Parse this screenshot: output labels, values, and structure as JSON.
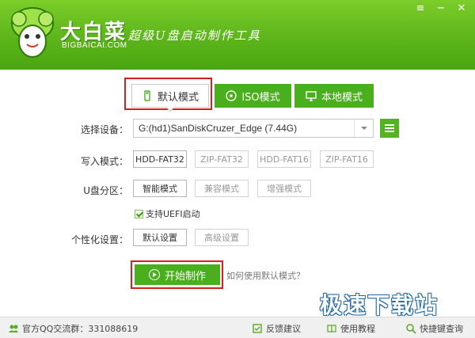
{
  "header": {
    "brand": "大白菜",
    "brand_sub": "BIGBAICAI.COM",
    "slogan": "超级U盘启动制作工具",
    "window_buttons": [
      "menu",
      "minimize",
      "close"
    ]
  },
  "tabs": [
    {
      "label": "默认模式",
      "icon": "usb-icon",
      "active": true
    },
    {
      "label": "ISO模式",
      "icon": "disc-icon",
      "active": false
    },
    {
      "label": "本地模式",
      "icon": "monitor-icon",
      "active": false
    }
  ],
  "form": {
    "device_label": "选择设备：",
    "device_value": "G:(hd1)SanDiskCruzer_Edge (7.44G)",
    "write_mode_label": "写入模式：",
    "write_modes": [
      "HDD-FAT32",
      "ZIP-FAT32",
      "HDD-FAT16",
      "ZIP-FAT16"
    ],
    "write_mode_selected": "HDD-FAT32",
    "partition_label": "U盘分区：",
    "partition_modes": [
      "智能模式",
      "兼容模式",
      "增强模式"
    ],
    "partition_selected": "智能模式",
    "uefi_label": "支持UEFI启动",
    "uefi_checked": true,
    "personal_label": "个性化设置：",
    "personal_modes": [
      "默认设置",
      "高级设置"
    ],
    "personal_selected": "默认设置"
  },
  "actions": {
    "start_label": "开始制作",
    "help_link": "如何使用默认模式？"
  },
  "footer": {
    "qq_group": "官方QQ交流群：331088619",
    "feedback": "反馈建议",
    "tutorial": "使用教程",
    "shortcut": "快捷键查询"
  },
  "watermark": "极速下载站",
  "colors": {
    "accent": "#4aaf1d",
    "header": "#5cb51a",
    "highlight": "#d5201c"
  }
}
